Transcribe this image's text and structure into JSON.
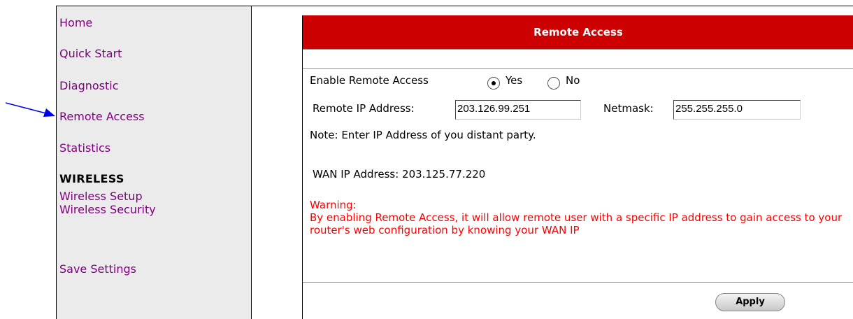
{
  "sidebar": {
    "links": {
      "home": "Home",
      "quick_start": "Quick Start",
      "diagnostic": "Diagnostic",
      "remote_access": "Remote Access",
      "statistics": "Statistics",
      "wireless_setup": "Wireless Setup",
      "wireless_security": "Wireless Security",
      "save_settings": "Save Settings"
    },
    "wireless_heading": "WIRELESS"
  },
  "panel": {
    "title": "Remote Access",
    "enable_label": "Enable Remote Access",
    "yes_label": "Yes",
    "no_label": "No",
    "enabled": "Yes",
    "remote_ip_label": "Remote IP Address:",
    "remote_ip_value": "203.126.99.251",
    "netmask_label": "Netmask:",
    "netmask_value": "255.255.255.0",
    "note": "Note: Enter IP Address of you distant party.",
    "wan_ip": "WAN IP Address: 203.125.77.220",
    "warning_title": "Warning:",
    "warning_text": "By enabling Remote Access, it will allow remote user with a specific IP address to gain access to your router's web configuration by knowing your WAN IP",
    "apply_label": "Apply"
  },
  "colors": {
    "header_red": "#cc0000",
    "link_purple": "#800080",
    "warning_red": "#ff0000",
    "arrow_blue": "#0000ee"
  }
}
